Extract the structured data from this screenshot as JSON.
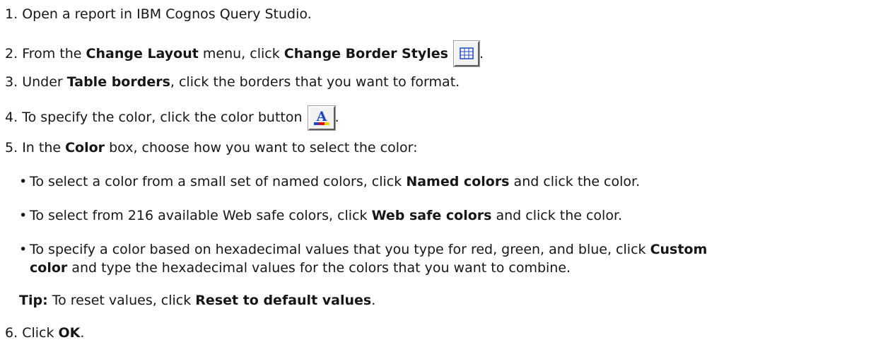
{
  "steps": {
    "s1": {
      "num": "1.",
      "text": "Open a report in IBM Cognos Query Studio."
    },
    "s2": {
      "num": "2.",
      "pre": "From the",
      "menu": "Change Layout",
      "mid": "menu, click",
      "cmd": "Change Border Styles",
      "end": ".",
      "icon": "border-grid-icon"
    },
    "s3": {
      "num": "3.",
      "pre": "Under",
      "label": "Table borders",
      "post": ", click the borders that you want to format."
    },
    "s4": {
      "num": "4.",
      "text": "To specify the color, click the color button",
      "end": ".",
      "icon": "font-color-icon"
    },
    "s5": {
      "num": "5.",
      "pre": "In the",
      "label": "Color",
      "post": "box, choose how you want to select the color:",
      "bullets": [
        {
          "pre": "To select a color from a small set of named colors, click",
          "bold": "Named colors",
          "post": "and click the color."
        },
        {
          "pre": "To select from 216 available Web safe colors, click",
          "bold": "Web safe colors",
          "post": "and click the color."
        },
        {
          "pre": "To specify a color based on hexadecimal values that you type for red, green, and blue, click",
          "bold1": "Custom",
          "bold2": "color",
          "post": "and type the hexadecimal values for the colors that you want to combine."
        }
      ],
      "tip": {
        "label": "Tip:",
        "pre": "To reset values, click",
        "bold": "Reset to default values",
        "end": "."
      }
    },
    "s6": {
      "num": "6.",
      "pre": "Click",
      "bold": "OK",
      "end": "."
    }
  },
  "colors": {
    "text": "#161616",
    "icon_blue": "#1a46c8",
    "icon_red": "#e01010",
    "icon_yellow": "#f0d000"
  }
}
